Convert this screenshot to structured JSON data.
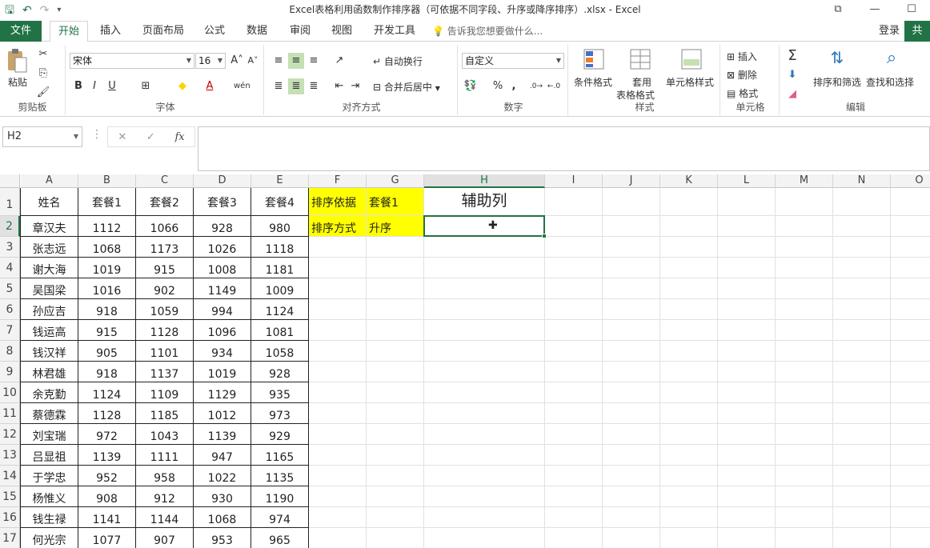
{
  "window": {
    "title": "Excel表格利用函数制作排序器（可依据不同字段、升序或降序排序）.xlsx - Excel",
    "controls": [
      "⧉",
      "—",
      "☐"
    ]
  },
  "qat": {
    "save": "🖫",
    "undo": "↶",
    "redo": "↷",
    "customize": "▾"
  },
  "tabs": {
    "file": "文件",
    "items": [
      "开始",
      "插入",
      "页面布局",
      "公式",
      "数据",
      "审阅",
      "视图",
      "开发工具"
    ],
    "tellme": "告诉我您想要做什么...",
    "login": "登录",
    "share": "共"
  },
  "ribbon": {
    "clipboard": {
      "label": "剪贴板",
      "paste": "粘贴"
    },
    "font": {
      "label": "字体",
      "name": "宋体",
      "size": "16",
      "grow": "A˄",
      "shrink": "A˅",
      "bold": "B",
      "italic": "I",
      "underline": "U",
      "phonetic": "wén"
    },
    "alignment": {
      "label": "对齐方式",
      "wrap": "自动换行",
      "merge": "合并后居中"
    },
    "number": {
      "label": "数字",
      "format": "自定义",
      "percent": "%",
      "comma": ","
    },
    "styles": {
      "label": "样式",
      "conditional": "条件格式",
      "table_line1": "套用",
      "table_line2": "表格格式",
      "cell_styles": "单元格样式"
    },
    "cells": {
      "label": "单元格",
      "insert": "插入",
      "delete": "删除",
      "format": "格式"
    },
    "editing": {
      "label": "编辑",
      "sort_filter": "排序和筛选",
      "find_select": "查找和选择"
    }
  },
  "formula_bar": {
    "name_box": "H2",
    "cancel": "✕",
    "enter": "✓",
    "fx": "fx",
    "value": ""
  },
  "grid": {
    "columns": [
      "A",
      "B",
      "C",
      "D",
      "E",
      "F",
      "G",
      "H",
      "I",
      "J",
      "K",
      "L",
      "M",
      "N",
      "O"
    ],
    "selected_column": "H",
    "selected_row": "2",
    "rows": [
      "1",
      "2",
      "3",
      "4",
      "5",
      "6",
      "7",
      "8",
      "9",
      "10",
      "11",
      "12",
      "13",
      "14",
      "15",
      "16",
      "17"
    ],
    "headers": [
      "姓名",
      "套餐1",
      "套餐2",
      "套餐3",
      "套餐4"
    ],
    "data": [
      [
        "章汉夫",
        "1112",
        "1066",
        "928",
        "980"
      ],
      [
        "张志远",
        "1068",
        "1173",
        "1026",
        "1118"
      ],
      [
        "谢大海",
        "1019",
        "915",
        "1008",
        "1181"
      ],
      [
        "吴国梁",
        "1016",
        "902",
        "1149",
        "1009"
      ],
      [
        "孙应吉",
        "918",
        "1059",
        "994",
        "1124"
      ],
      [
        "钱运高",
        "915",
        "1128",
        "1096",
        "1081"
      ],
      [
        "钱汉祥",
        "905",
        "1101",
        "934",
        "1058"
      ],
      [
        "林君雄",
        "918",
        "1137",
        "1019",
        "928"
      ],
      [
        "余克勤",
        "1124",
        "1109",
        "1129",
        "935"
      ],
      [
        "蔡德霖",
        "1128",
        "1185",
        "1012",
        "973"
      ],
      [
        "刘宝瑞",
        "972",
        "1043",
        "1139",
        "929"
      ],
      [
        "吕显祖",
        "1139",
        "1111",
        "947",
        "1165"
      ],
      [
        "于学忠",
        "952",
        "958",
        "1022",
        "1135"
      ],
      [
        "杨惟义",
        "908",
        "912",
        "930",
        "1190"
      ],
      [
        "钱生禄",
        "1141",
        "1144",
        "1068",
        "974"
      ],
      [
        "何光宗",
        "1077",
        "907",
        "953",
        "965"
      ]
    ],
    "F1": "排序依据",
    "G1": "套餐1",
    "H1": "辅助列",
    "F2": "排序方式",
    "G2": "升序"
  },
  "colors": {
    "accent": "#217346",
    "highlight": "#ffff00"
  }
}
